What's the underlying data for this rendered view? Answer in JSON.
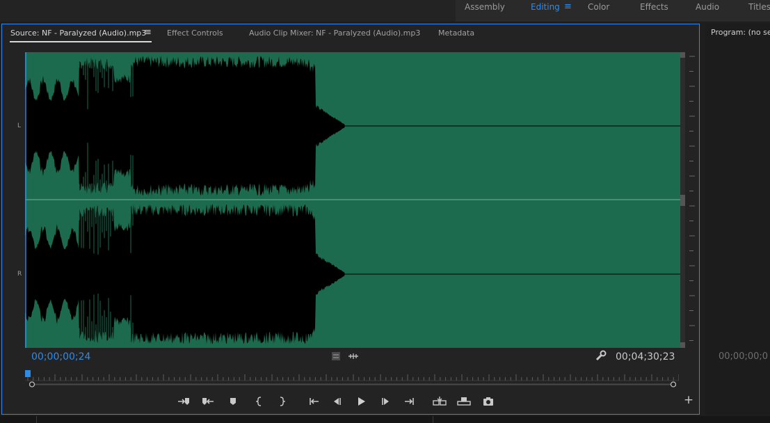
{
  "workspace": {
    "tabs": [
      {
        "label": "Assembly",
        "active": false
      },
      {
        "label": "Editing",
        "active": true
      },
      {
        "label": "Color",
        "active": false
      },
      {
        "label": "Effects",
        "active": false
      },
      {
        "label": "Audio",
        "active": false
      },
      {
        "label": "Titles",
        "active": false
      }
    ],
    "menu_icon": "hamburger-icon",
    "accent_color": "#2d8ceb"
  },
  "source_panel": {
    "tabs": [
      {
        "label": "Source: NF - Paralyzed (Audio).mp3",
        "active": true
      },
      {
        "label": "Effect Controls",
        "active": false
      },
      {
        "label": "Audio Clip Mixer: NF - Paralyzed (Audio).mp3",
        "active": false
      },
      {
        "label": "Metadata",
        "active": false
      }
    ],
    "channels": {
      "left": "L",
      "right": "R"
    },
    "waveform_color": "#1d6b4f",
    "current_timecode": "00;00;00;24",
    "duration_timecode": "00;04;30;23",
    "playhead_fraction": 0.003,
    "controls": [
      {
        "name": "mark-in-icon"
      },
      {
        "name": "mark-out-icon"
      },
      {
        "name": "add-marker-icon"
      },
      {
        "name": "go-to-in-bracket-icon"
      },
      {
        "name": "go-to-out-bracket-icon"
      },
      {
        "name": "go-to-in-icon"
      },
      {
        "name": "step-back-icon"
      },
      {
        "name": "play-icon"
      },
      {
        "name": "step-forward-icon"
      },
      {
        "name": "go-to-out-icon"
      },
      {
        "name": "insert-icon"
      },
      {
        "name": "overwrite-icon"
      },
      {
        "name": "export-frame-icon"
      }
    ]
  },
  "program_panel": {
    "title": "Program: (no se",
    "timecode": "00;00;00;0"
  }
}
